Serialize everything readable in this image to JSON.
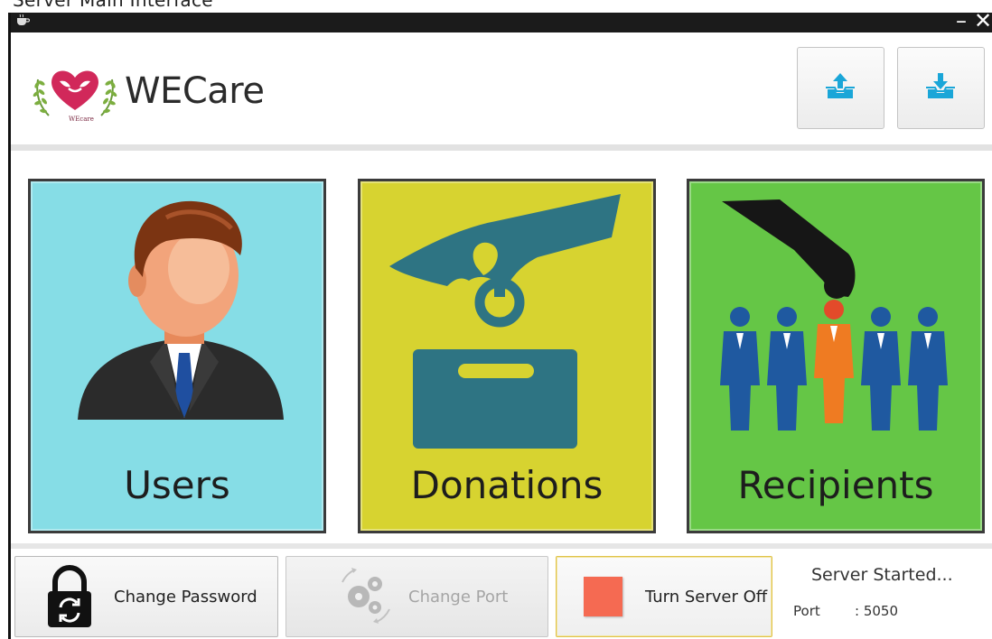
{
  "window": {
    "caption": "Server Main Interface",
    "minimize_glyph": "–",
    "close_glyph": "✕"
  },
  "header": {
    "app_name": "WECare",
    "logo_text": "WEcare",
    "upload_icon": "upload-tray-icon",
    "download_icon": "download-tray-icon"
  },
  "tiles": [
    {
      "label": "Users",
      "color": "#86dde6",
      "icon": "user-avatar-icon"
    },
    {
      "label": "Donations",
      "color": "#d7d330",
      "icon": "donation-box-icon"
    },
    {
      "label": "Recipients",
      "color": "#65c646",
      "icon": "recipients-selection-icon"
    }
  ],
  "footer": {
    "change_password_label": "Change Password",
    "change_port_label": "Change Port",
    "server_toggle_label": "Turn Server Off",
    "status_text": "Server Started...",
    "port_label": "Port",
    "port_value": ": 5050"
  },
  "colors": {
    "accent_blue": "#1aa6d8",
    "server_off_red": "#f56a52",
    "titlebar": "#1b1b1b"
  }
}
